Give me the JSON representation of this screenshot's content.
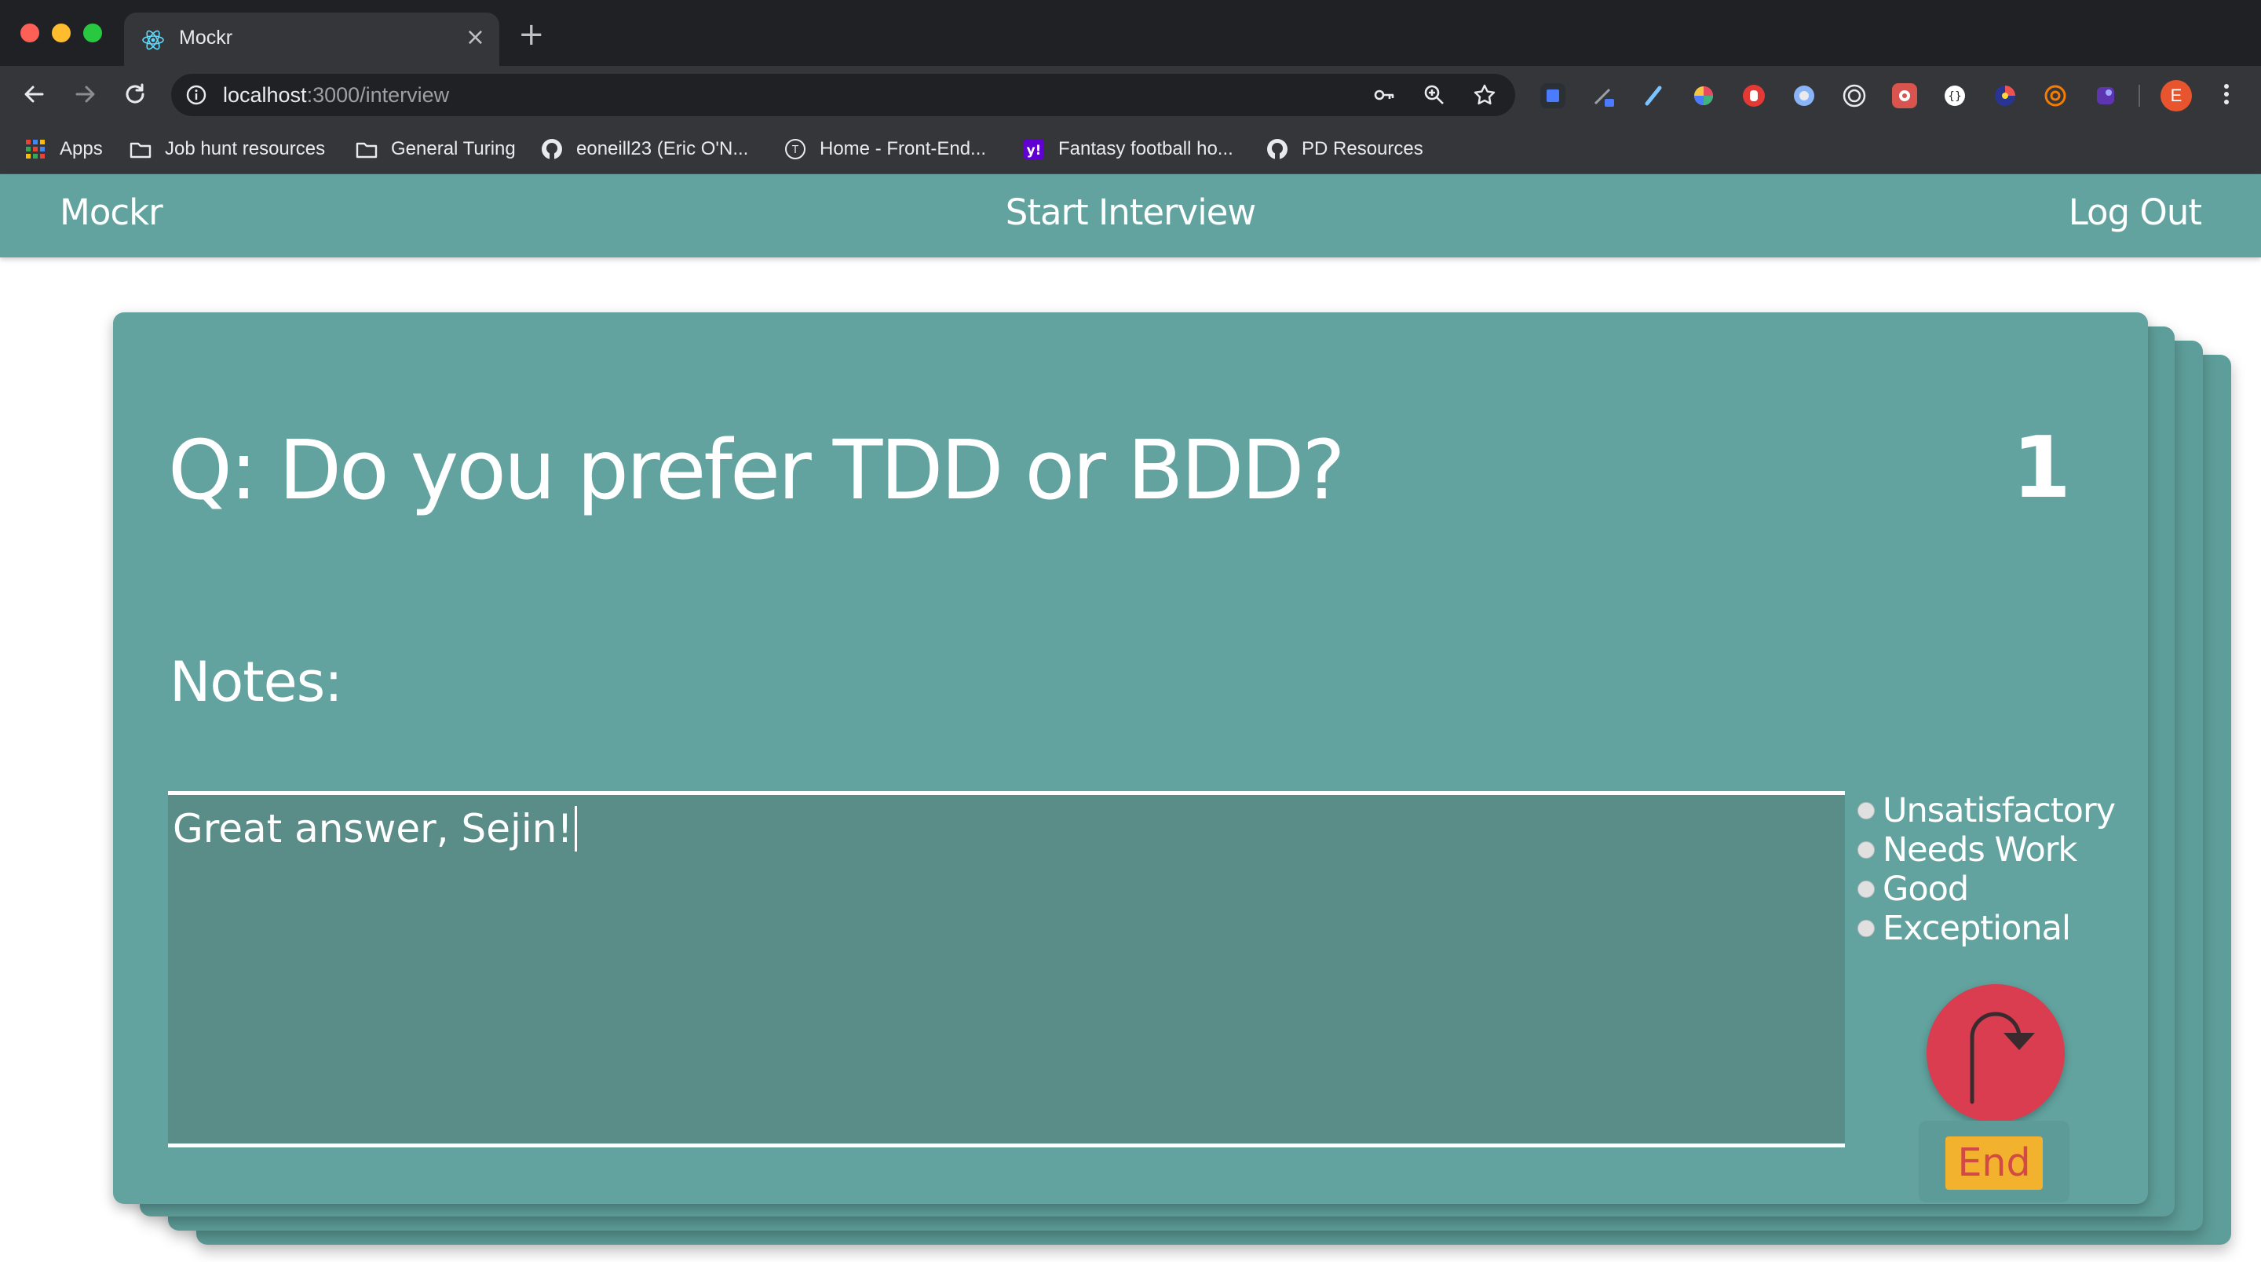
{
  "browser": {
    "tab_title": "Mockr",
    "tab_close": "×",
    "new_tab": "+",
    "url_host": "localhost",
    "url_path": ":3000/interview",
    "profile_initial": "E",
    "bookmarks": [
      {
        "label": "Apps",
        "icon": "apps-grid-icon"
      },
      {
        "label": "Job hunt resources",
        "icon": "folder-icon"
      },
      {
        "label": "General Turing",
        "icon": "folder-icon"
      },
      {
        "label": "eoneill23 (Eric O'N...",
        "icon": "github-icon"
      },
      {
        "label": "Home - Front-End...",
        "icon": "turing-icon"
      },
      {
        "label": "Fantasy football ho...",
        "icon": "yahoo-icon"
      },
      {
        "label": "PD Resources",
        "icon": "github-icon"
      }
    ]
  },
  "app": {
    "brand": "Mockr",
    "start_interview": "Start Interview",
    "logout": "Log Out"
  },
  "interview": {
    "question": "Q: Do you prefer TDD or BDD?",
    "question_number": "1",
    "notes_label": "Notes:",
    "notes_value": "Great answer, Sejin!",
    "ratings": [
      "Unsatisfactory",
      "Needs Work",
      "Good",
      "Exceptional"
    ],
    "end_label": "End"
  },
  "colors": {
    "app_teal": "#62a39f",
    "next_button_red": "#d93d4f",
    "end_button_yellow": "#f2b22e"
  }
}
